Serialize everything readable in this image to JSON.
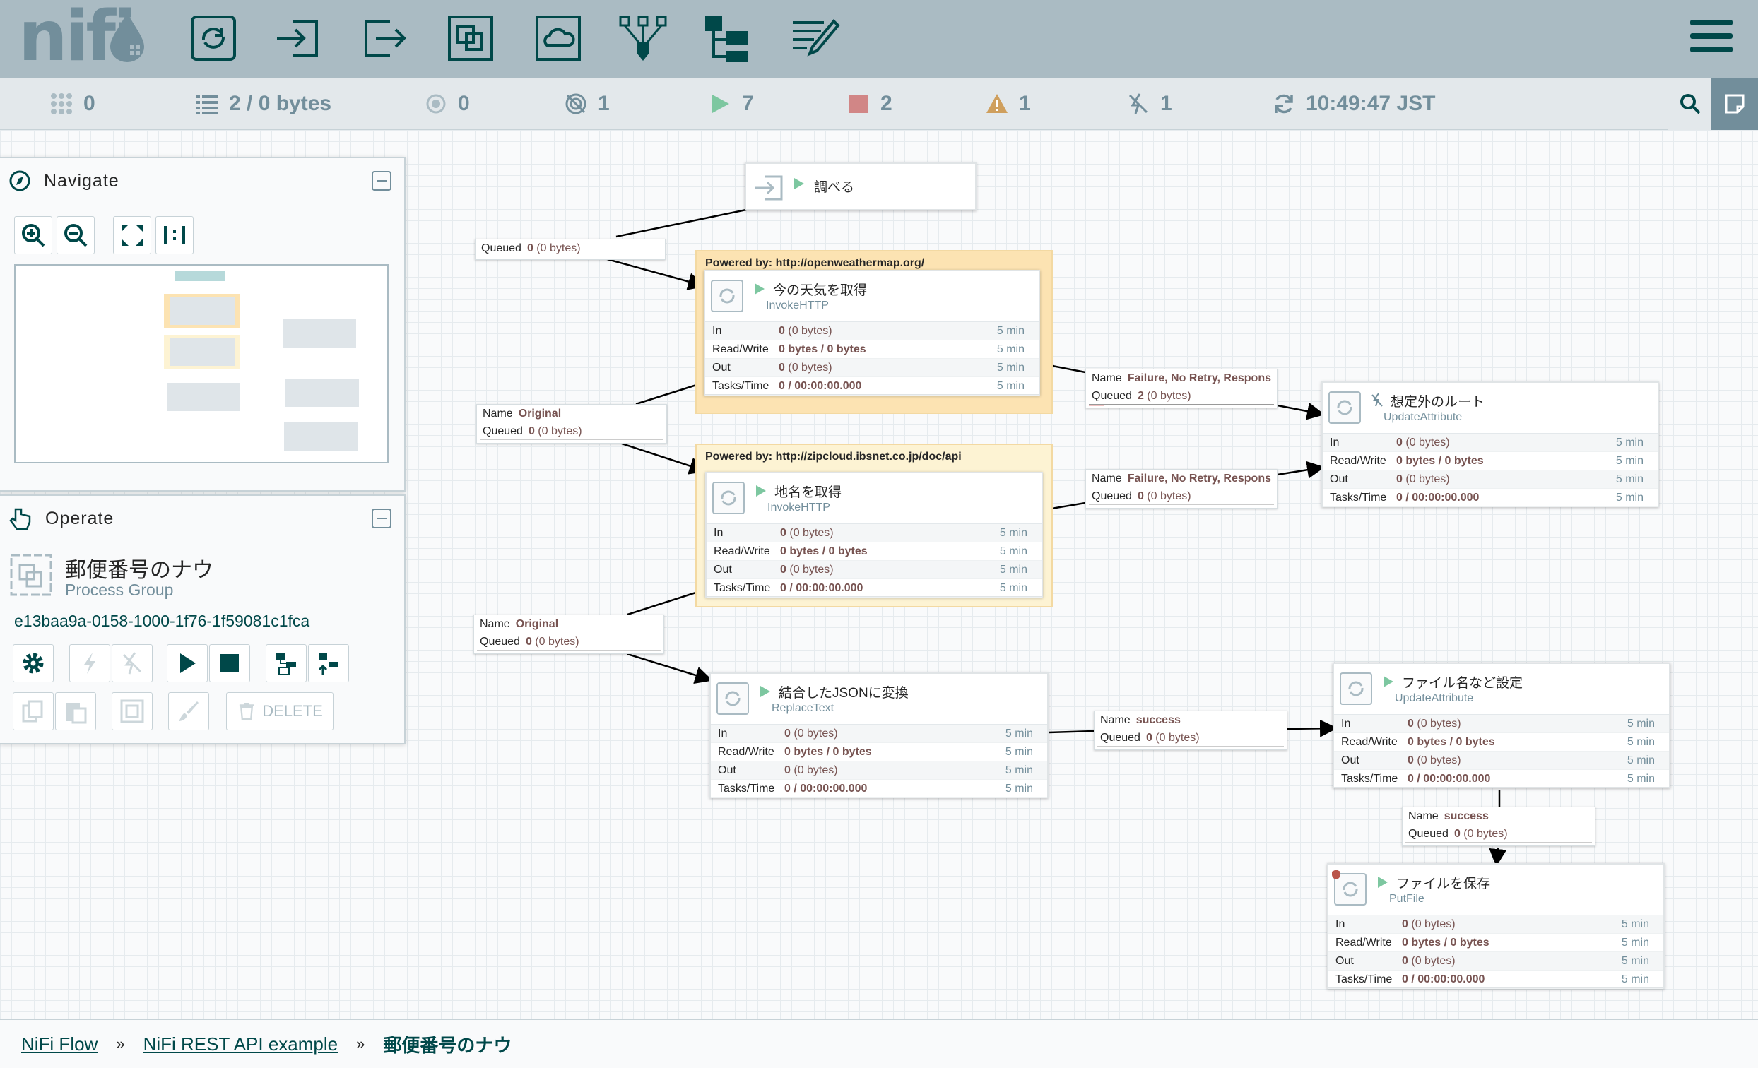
{
  "app": {
    "logo_text": "nifi"
  },
  "toolbar": {
    "icons": [
      "processor-icon",
      "input-port-icon",
      "output-port-icon",
      "process-group-icon",
      "remote-process-group-icon",
      "funnel-icon",
      "template-icon",
      "label-icon"
    ]
  },
  "status": {
    "transmitting": "0",
    "flowfiles": "2 / 0 bytes",
    "not_transmitting": "0",
    "invalid": "1",
    "running": "7",
    "stopped": "2",
    "warnings": "1",
    "disabled": "1",
    "time": "10:49:47 JST"
  },
  "navigate": {
    "title": "Navigate"
  },
  "operate": {
    "title": "Operate",
    "group_name": "郵便番号のナウ",
    "group_type": "Process Group",
    "group_id": "e13baa9a-0158-1000-1f76-1f59081c1fca",
    "delete_label": "DELETE"
  },
  "stat_labels": {
    "in": "In",
    "rw": "Read/Write",
    "out": "Out",
    "tasks": "Tasks/Time"
  },
  "stats_common": {
    "in_count": "0",
    "in_bytes": "(0 bytes)",
    "rw": "0 bytes / 0 bytes",
    "out_count": "0",
    "out_bytes": "(0 bytes)",
    "tasks": "0 / 00:00:00.000",
    "window": "5 min"
  },
  "port_check": {
    "name": "調べる"
  },
  "groups": {
    "weather_banner": "Powered by: http://openweathermap.org/",
    "zip_banner": "Powered by: http://zipcloud.ibsnet.co.jp/doc/api"
  },
  "processors": {
    "weather": {
      "name": "今の天気を取得",
      "type": "InvokeHTTP"
    },
    "place": {
      "name": "地名を取得",
      "type": "InvokeHTTP"
    },
    "unexpected": {
      "name": "想定外のルート",
      "type": "UpdateAttribute"
    },
    "json": {
      "name": "結合したJSONに変換",
      "type": "ReplaceText"
    },
    "filename": {
      "name": "ファイル名など設定",
      "type": "UpdateAttribute"
    },
    "save": {
      "name": "ファイルを保存",
      "type": "PutFile"
    }
  },
  "connections": {
    "name_key": "Name",
    "queued_key": "Queued",
    "c1": {
      "queued_count": "0",
      "queued_bytes": "(0 bytes)"
    },
    "c2": {
      "name": "Original",
      "queued_count": "0",
      "queued_bytes": "(0 bytes)"
    },
    "c3": {
      "name": "Original",
      "queued_count": "0",
      "queued_bytes": "(0 bytes)"
    },
    "c4": {
      "name": "Failure, No Retry, Respons...",
      "queued_count": "2",
      "queued_bytes": "(0 bytes)"
    },
    "c5": {
      "name": "Failure, No Retry, Respons...",
      "queued_count": "0",
      "queued_bytes": "(0 bytes)"
    },
    "c6": {
      "name": "success",
      "queued_count": "0",
      "queued_bytes": "(0 bytes)"
    },
    "c7": {
      "name": "success",
      "queued_count": "0",
      "queued_bytes": "(0 bytes)"
    }
  },
  "breadcrumb": {
    "root": "NiFi Flow",
    "parent": "NiFi REST API example",
    "current": "郵便番号のナウ",
    "sep": "»"
  }
}
